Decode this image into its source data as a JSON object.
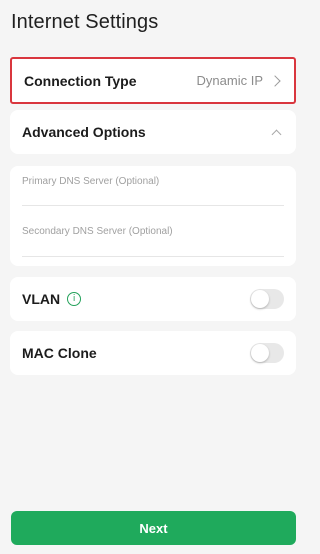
{
  "header": {
    "title": "Internet Settings"
  },
  "connection_type": {
    "label": "Connection Type",
    "value": "Dynamic IP",
    "highlight_color": "#d9363e"
  },
  "advanced_options": {
    "label": "Advanced Options",
    "expanded": true
  },
  "dns": {
    "primary_placeholder": "Primary DNS Server (Optional)",
    "primary_value": "",
    "secondary_placeholder": "Secondary DNS Server (Optional)",
    "secondary_value": ""
  },
  "vlan": {
    "label": "VLAN",
    "enabled": false,
    "info_icon": "info-icon"
  },
  "mac_clone": {
    "label": "MAC Clone",
    "enabled": false
  },
  "footer": {
    "next_label": "Next",
    "accent_color": "#1faa5c"
  }
}
